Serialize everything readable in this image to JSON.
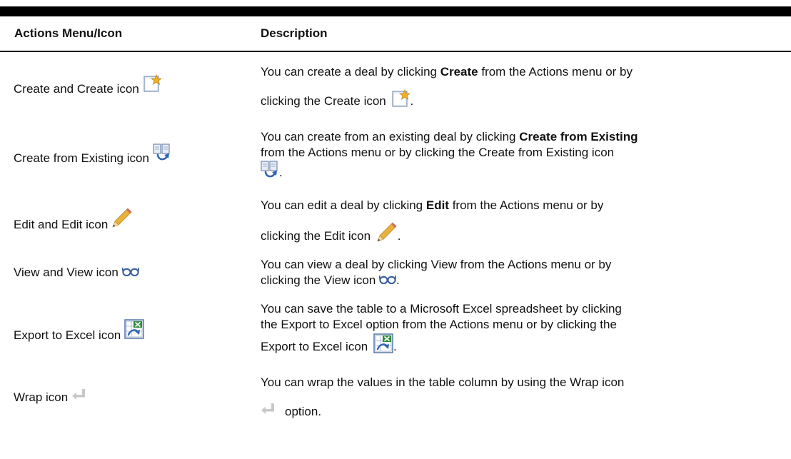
{
  "table": {
    "headers": {
      "actions": "Actions Menu/Icon",
      "description": "Description"
    },
    "rows": [
      {
        "label": "Create and Create icon",
        "icon": "create-icon",
        "desc_a": "You can create a deal by clicking ",
        "desc_b": "Create",
        "desc_c": " from the Actions menu or by",
        "desc_d": "clicking the Create icon ",
        "desc_e": "."
      },
      {
        "label": "Create from Existing icon",
        "icon": "create-from-existing-icon",
        "desc_a": "You can create from an existing deal by clicking ",
        "desc_b": "Create from Existing",
        "desc_c": "from the Actions menu or by clicking the Create from Existing icon",
        "desc_e": "."
      },
      {
        "label": "Edit and Edit icon",
        "icon": "pencil-icon",
        "desc_a": "You can edit a deal by clicking ",
        "desc_b": "Edit",
        "desc_c": " from the Actions menu or by",
        "desc_d": "clicking the Edit icon ",
        "desc_e": "."
      },
      {
        "label": "View and View icon",
        "icon": "glasses-icon",
        "desc_a": "You can view a deal by clicking View from the Actions menu or by",
        "desc_d": "clicking the View icon ",
        "desc_e": "."
      },
      {
        "label": "Export to Excel icon",
        "icon": "excel-export-icon",
        "desc_a": "You can save the table to a Microsoft Excel spreadsheet by clicking",
        "desc_c": "the Export to Excel option from the Actions menu or by clicking the",
        "desc_d": "Export to Excel icon ",
        "desc_e": "."
      },
      {
        "label": "Wrap icon",
        "icon": "wrap-icon",
        "desc_a": "You can wrap the values in the table column by using the Wrap icon",
        "desc_d": "option."
      }
    ]
  },
  "colors": {
    "rule": "#000000",
    "text": "#111111",
    "create_icon_star": "#f2b320",
    "pencil": "#e8b23a",
    "excel_green": "#2e8b3a",
    "wrap_gray": "#c8c8c8"
  }
}
